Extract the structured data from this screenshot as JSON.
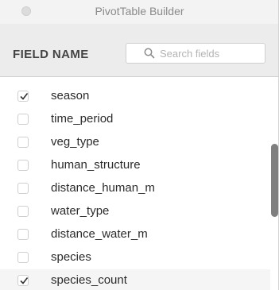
{
  "window": {
    "title": "PivotTable Builder"
  },
  "header": {
    "field_name_label": "FIELD NAME",
    "search": {
      "placeholder": "Search fields",
      "value": ""
    }
  },
  "fields": [
    {
      "label": "season",
      "checked": true
    },
    {
      "label": "time_period",
      "checked": false
    },
    {
      "label": "veg_type",
      "checked": false
    },
    {
      "label": "human_structure",
      "checked": false
    },
    {
      "label": "distance_human_m",
      "checked": false
    },
    {
      "label": "water_type",
      "checked": false
    },
    {
      "label": "distance_water_m",
      "checked": false
    },
    {
      "label": "species",
      "checked": false
    },
    {
      "label": "species_count",
      "checked": true
    }
  ],
  "colors": {
    "window_bg": "#ececec",
    "list_bg": "#ffffff",
    "scroll_thumb": "#7f7f7f"
  },
  "icons": {
    "window_control": "window-control-dot",
    "search": "search-icon",
    "checkmark": "checkmark-icon"
  }
}
